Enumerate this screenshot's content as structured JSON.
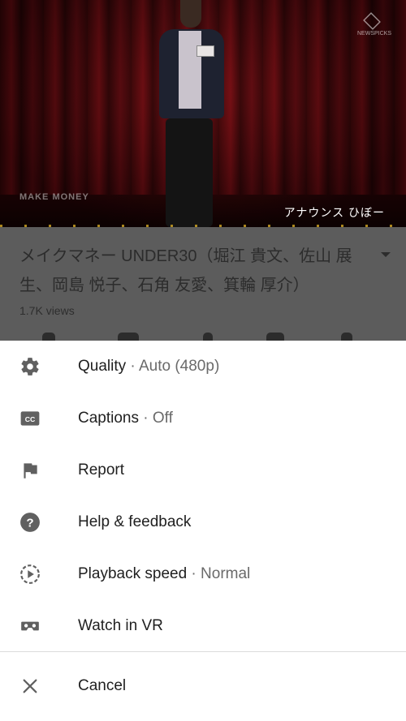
{
  "video": {
    "overlay_caption": "アナウンス ひぼー",
    "bottom_left_logo": "MAKE MONEY",
    "top_right_logo": "NEWSPICKS"
  },
  "info": {
    "title": "メイクマネー UNDER30（堀江 貴文、佐山 展生、岡島 悦子、石角 友愛、箕輪 厚介）",
    "views": "1.7K views"
  },
  "menu": {
    "items": [
      {
        "id": "quality",
        "label": "Quality",
        "separator": " · ",
        "value": "Auto (480p)",
        "icon": "gear-icon"
      },
      {
        "id": "captions",
        "label": "Captions",
        "separator": " · ",
        "value": "Off",
        "icon": "closed-captions-icon"
      },
      {
        "id": "report",
        "label": "Report",
        "separator": "",
        "value": "",
        "icon": "flag-icon"
      },
      {
        "id": "help",
        "label": "Help & feedback",
        "separator": "",
        "value": "",
        "icon": "help-icon"
      },
      {
        "id": "speed",
        "label": "Playback speed",
        "separator": " · ",
        "value": "Normal",
        "icon": "playback-speed-icon"
      },
      {
        "id": "vr",
        "label": "Watch in VR",
        "separator": "",
        "value": "",
        "icon": "vr-headset-icon"
      }
    ],
    "cancel_label": "Cancel"
  },
  "colors": {
    "sheet_bg": "#ffffff",
    "text_primary": "#1f1f1f",
    "text_secondary": "#6a6a6a",
    "icon": "#606060",
    "dim_overlay": "#5c5c5c"
  }
}
